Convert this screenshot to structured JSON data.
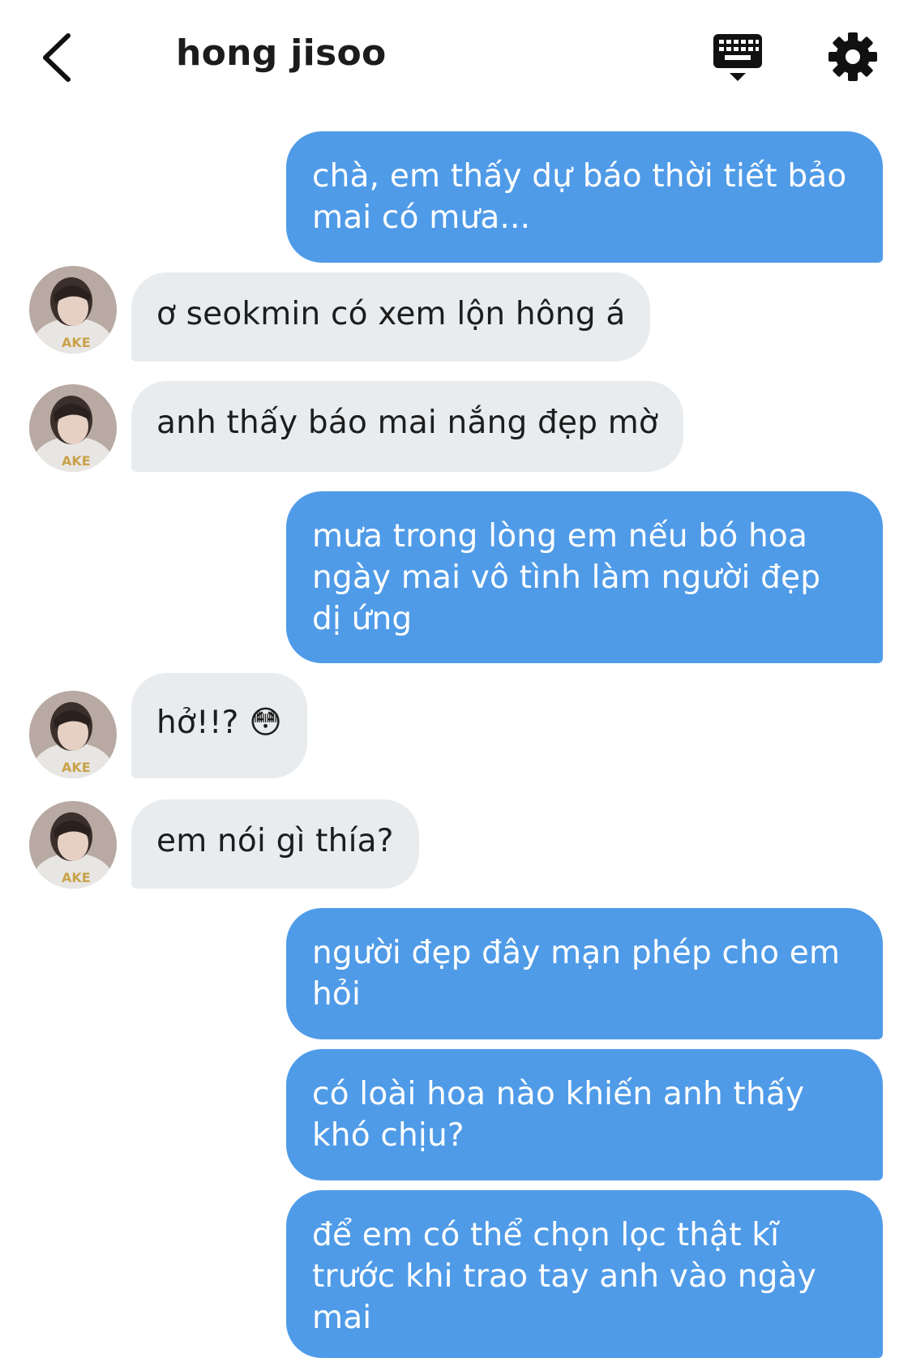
{
  "header": {
    "title": "hong jisoo",
    "back_icon": "chevron-left-icon",
    "keyboard_icon": "keyboard-icon",
    "settings_icon": "gear-icon"
  },
  "colors": {
    "sent_bubble": "#4f9be8",
    "received_bubble": "#e9ecef",
    "icon": "#111111"
  },
  "messages": [
    {
      "sender": "me",
      "text": "chà, em thấy dự báo thời tiết bảo mai có mưa..."
    },
    {
      "sender": "them",
      "text": "ơ seokmin có xem lộn hông á"
    },
    {
      "sender": "them",
      "text": "anh thấy báo mai nắng đẹp mờ"
    },
    {
      "sender": "me",
      "text": "mưa trong lòng em nếu bó hoa ngày mai vô tình làm người đẹp dị ứng"
    },
    {
      "sender": "them",
      "text": "hở!!? 😳"
    },
    {
      "sender": "them",
      "text": "em nói gì thía?"
    },
    {
      "sender": "me",
      "text": "người đẹp đây mạn phép cho em hỏi"
    },
    {
      "sender": "me",
      "text": "có loài hoa nào khiến anh thấy khó chịu?"
    },
    {
      "sender": "me",
      "text": "để em có thể chọn lọc thật kĩ trước khi trao tay anh vào ngày mai"
    }
  ]
}
